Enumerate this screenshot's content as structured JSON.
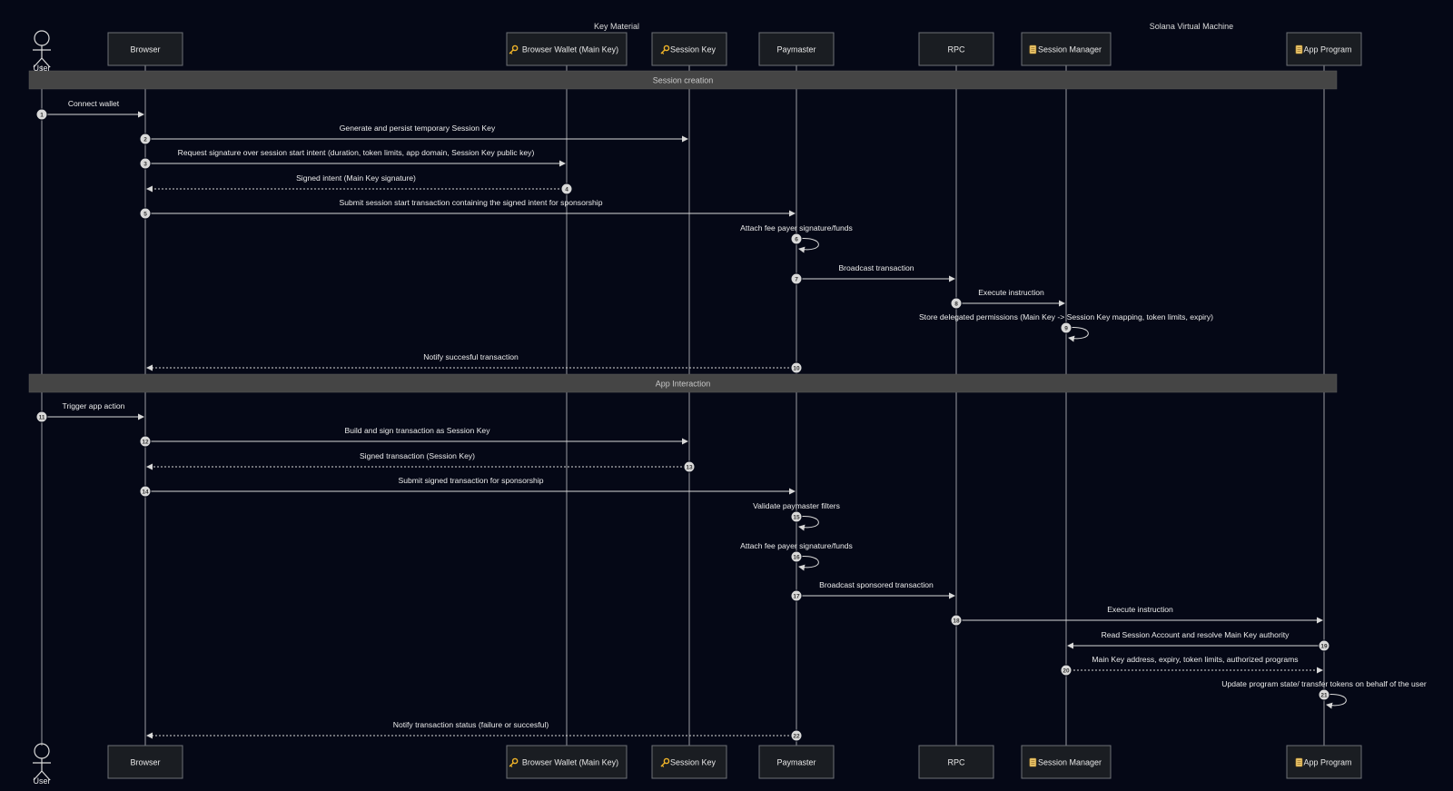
{
  "groups": [
    {
      "label": "Key Material"
    },
    {
      "label": "Solana Virtual Machine"
    }
  ],
  "participants": [
    {
      "id": "user",
      "label": "User",
      "kind": "stick"
    },
    {
      "id": "browser",
      "label": "Browser",
      "kind": "box"
    },
    {
      "id": "wallet",
      "label": "Browser Wallet (Main Key)",
      "icon": "key",
      "kind": "box"
    },
    {
      "id": "sessionkey",
      "label": "Session Key",
      "icon": "key",
      "kind": "box"
    },
    {
      "id": "paymaster",
      "label": "Paymaster",
      "kind": "box"
    },
    {
      "id": "rpc",
      "label": "RPC",
      "kind": "box"
    },
    {
      "id": "sessionmanager",
      "label": "Session Manager",
      "icon": "scroll",
      "kind": "box"
    },
    {
      "id": "appprogram",
      "label": "App Program",
      "icon": "scroll",
      "kind": "box"
    }
  ],
  "sections": [
    {
      "label": "Session creation"
    },
    {
      "label": "App Interaction"
    }
  ],
  "messages": [
    {
      "n": "1",
      "from": "user",
      "to": "browser",
      "text": "Connect wallet",
      "dotted": false
    },
    {
      "n": "2",
      "from": "browser",
      "to": "sessionkey",
      "text": "Generate and persist temporary Session Key",
      "dotted": false
    },
    {
      "n": "3",
      "from": "browser",
      "to": "wallet",
      "text": "Request signature over session start intent (duration, token limits, app domain, Session Key public key)",
      "dotted": false
    },
    {
      "n": "4",
      "from": "wallet",
      "to": "browser",
      "text": "Signed intent (Main Key signature)",
      "dotted": true
    },
    {
      "n": "5",
      "from": "browser",
      "to": "paymaster",
      "text": "Submit session start transaction containing the signed intent for sponsorship",
      "dotted": false
    },
    {
      "n": "6",
      "from": "paymaster",
      "to": "paymaster",
      "text": "Attach fee payer signature/funds",
      "dotted": false
    },
    {
      "n": "7",
      "from": "paymaster",
      "to": "rpc",
      "text": "Broadcast transaction",
      "dotted": false
    },
    {
      "n": "8",
      "from": "rpc",
      "to": "sessionmanager",
      "text": "Execute instruction",
      "dotted": false
    },
    {
      "n": "9",
      "from": "sessionmanager",
      "to": "sessionmanager",
      "text": "Store delegated permissions (Main Key -> Session Key mapping, token limits, expiry)",
      "dotted": false
    },
    {
      "n": "10",
      "from": "paymaster",
      "to": "browser",
      "text": "Notify succesful transaction",
      "dotted": true
    },
    {
      "n": "11",
      "from": "user",
      "to": "browser",
      "text": "Trigger app action",
      "dotted": false
    },
    {
      "n": "12",
      "from": "browser",
      "to": "sessionkey",
      "text": "Build and sign transaction as Session Key",
      "dotted": false
    },
    {
      "n": "13",
      "from": "sessionkey",
      "to": "browser",
      "text": "Signed transaction (Session Key)",
      "dotted": true
    },
    {
      "n": "14",
      "from": "browser",
      "to": "paymaster",
      "text": "Submit signed transaction for sponsorship",
      "dotted": false
    },
    {
      "n": "15",
      "from": "paymaster",
      "to": "paymaster",
      "text": "Validate paymaster filters",
      "dotted": false
    },
    {
      "n": "16",
      "from": "paymaster",
      "to": "paymaster",
      "text": "Attach fee payer signature/funds",
      "dotted": false
    },
    {
      "n": "17",
      "from": "paymaster",
      "to": "rpc",
      "text": "Broadcast sponsored transaction",
      "dotted": false
    },
    {
      "n": "18",
      "from": "rpc",
      "to": "appprogram",
      "text": "Execute instruction",
      "dotted": false
    },
    {
      "n": "19",
      "from": "appprogram",
      "to": "sessionmanager",
      "text": "Read Session Account and resolve Main Key authority",
      "dotted": false
    },
    {
      "n": "20",
      "from": "sessionmanager",
      "to": "appprogram",
      "text": "Main Key address, expiry, token limits, authorized programs",
      "dotted": true
    },
    {
      "n": "21",
      "from": "appprogram",
      "to": "appprogram",
      "text": "Update program state/ transfer tokens on behalf of the user",
      "dotted": false
    },
    {
      "n": "22",
      "from": "paymaster",
      "to": "browser",
      "text": "Notify transaction status (failure or succesful)",
      "dotted": true
    }
  ]
}
